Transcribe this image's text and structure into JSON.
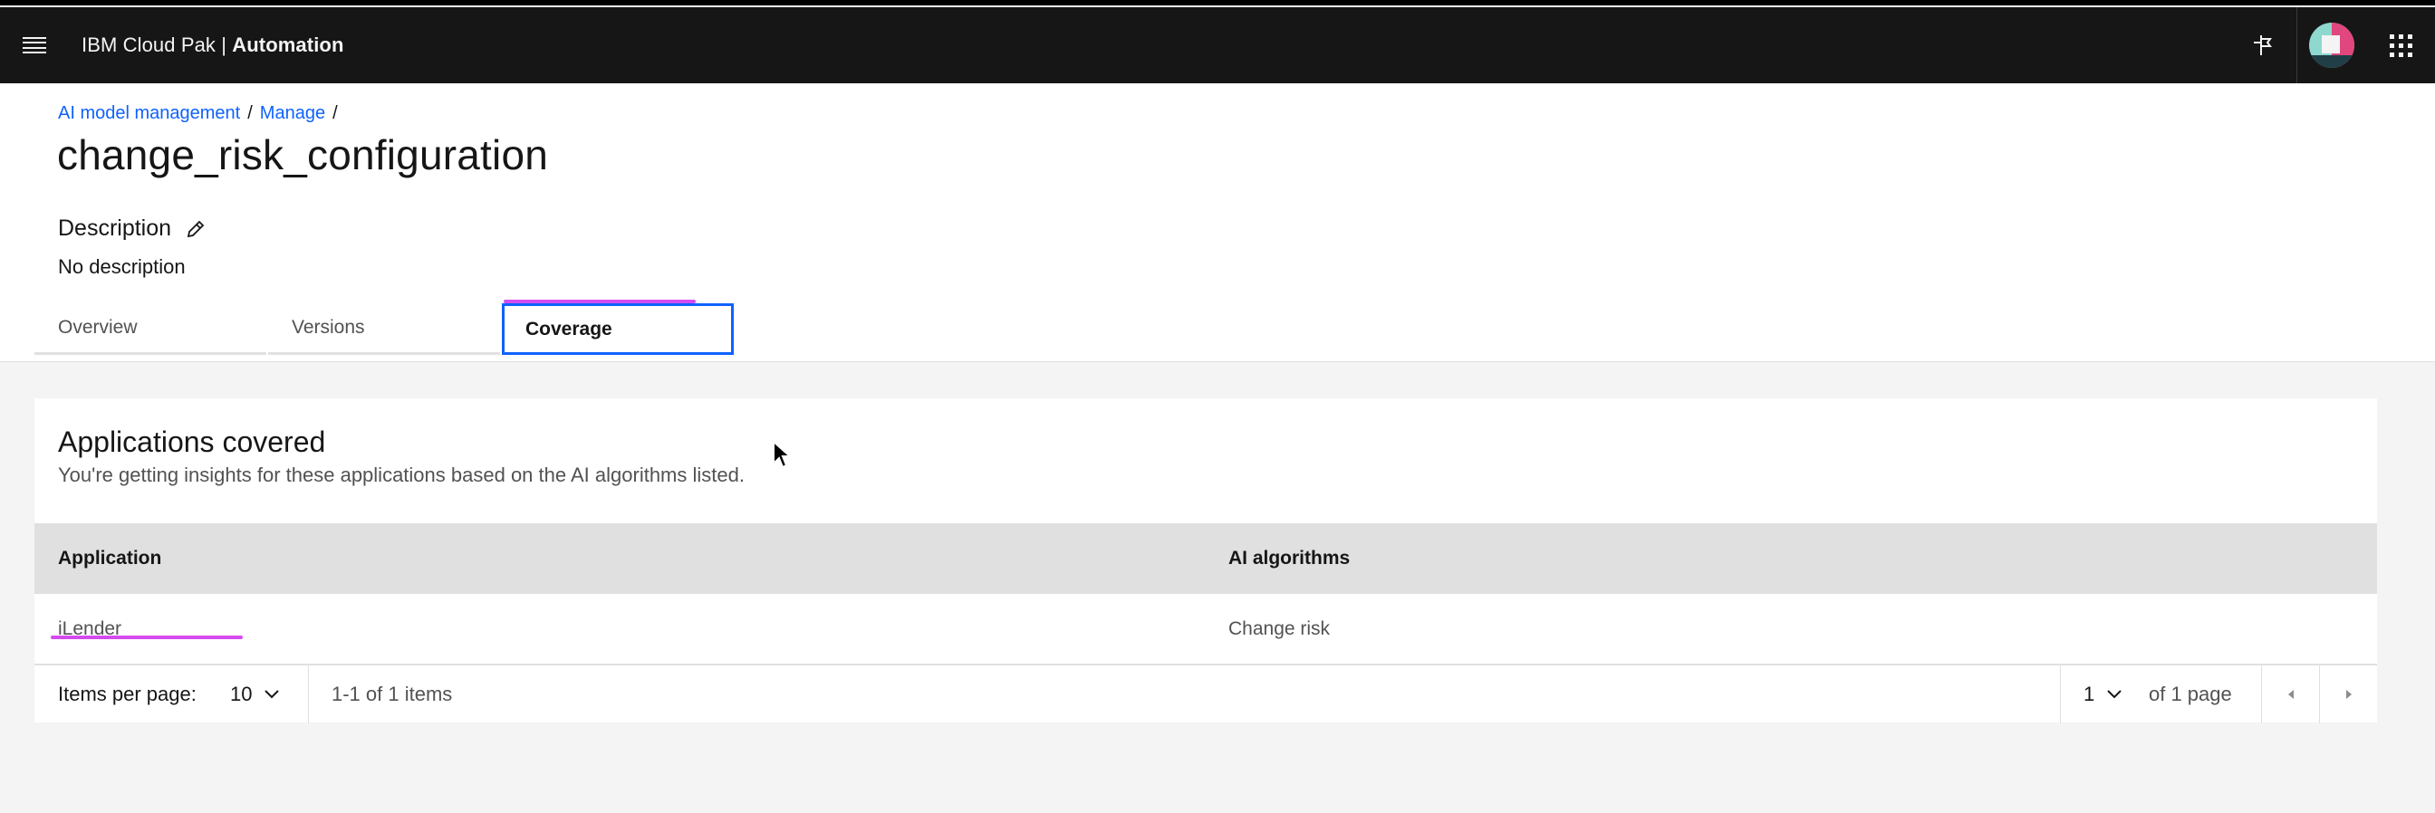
{
  "header": {
    "brand_prefix": "IBM Cloud Pak | ",
    "brand_product": "Automation",
    "icons": [
      "menu-icon",
      "signpost-icon",
      "avatar",
      "app-switcher-icon"
    ]
  },
  "breadcrumb": {
    "items": [
      "AI model management",
      "Manage"
    ],
    "separator": "/"
  },
  "page": {
    "title": "change_risk_configuration",
    "description_label": "Description",
    "description_value": "No description"
  },
  "tabs": [
    {
      "label": "Overview",
      "selected": false
    },
    {
      "label": "Versions",
      "selected": false
    },
    {
      "label": "Coverage",
      "selected": true
    }
  ],
  "coverage": {
    "title": "Applications covered",
    "subtitle": "You're getting insights for these applications based on the AI algorithms listed.",
    "columns": [
      "Application",
      "AI algorithms"
    ],
    "rows": [
      {
        "application": "iLender",
        "algorithms": "Change risk"
      }
    ],
    "pagination": {
      "items_per_page_label": "Items per page:",
      "items_per_page": "10",
      "range": "1-1 of 1 items",
      "page": "1",
      "of_pages": "of 1 page"
    }
  },
  "colors": {
    "header_bg": "#161616",
    "link": "#0f62fe",
    "focus": "#0f62fe",
    "highlight": "#d44bf0",
    "page_bg": "#f4f4f4"
  }
}
